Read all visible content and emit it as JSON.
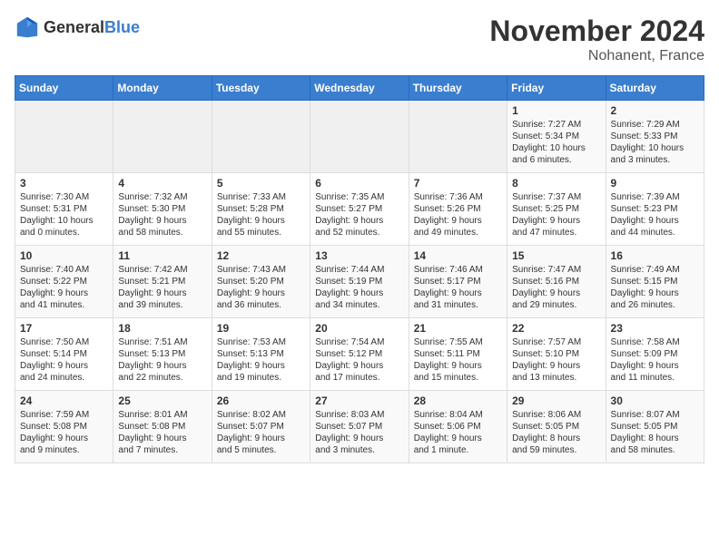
{
  "header": {
    "logo_general": "General",
    "logo_blue": "Blue",
    "title": "November 2024",
    "subtitle": "Nohanent, France"
  },
  "days_of_week": [
    "Sunday",
    "Monday",
    "Tuesday",
    "Wednesday",
    "Thursday",
    "Friday",
    "Saturday"
  ],
  "weeks": [
    [
      {
        "day": "",
        "info": ""
      },
      {
        "day": "",
        "info": ""
      },
      {
        "day": "",
        "info": ""
      },
      {
        "day": "",
        "info": ""
      },
      {
        "day": "",
        "info": ""
      },
      {
        "day": "1",
        "info": "Sunrise: 7:27 AM\nSunset: 5:34 PM\nDaylight: 10 hours\nand 6 minutes."
      },
      {
        "day": "2",
        "info": "Sunrise: 7:29 AM\nSunset: 5:33 PM\nDaylight: 10 hours\nand 3 minutes."
      }
    ],
    [
      {
        "day": "3",
        "info": "Sunrise: 7:30 AM\nSunset: 5:31 PM\nDaylight: 10 hours\nand 0 minutes."
      },
      {
        "day": "4",
        "info": "Sunrise: 7:32 AM\nSunset: 5:30 PM\nDaylight: 9 hours\nand 58 minutes."
      },
      {
        "day": "5",
        "info": "Sunrise: 7:33 AM\nSunset: 5:28 PM\nDaylight: 9 hours\nand 55 minutes."
      },
      {
        "day": "6",
        "info": "Sunrise: 7:35 AM\nSunset: 5:27 PM\nDaylight: 9 hours\nand 52 minutes."
      },
      {
        "day": "7",
        "info": "Sunrise: 7:36 AM\nSunset: 5:26 PM\nDaylight: 9 hours\nand 49 minutes."
      },
      {
        "day": "8",
        "info": "Sunrise: 7:37 AM\nSunset: 5:25 PM\nDaylight: 9 hours\nand 47 minutes."
      },
      {
        "day": "9",
        "info": "Sunrise: 7:39 AM\nSunset: 5:23 PM\nDaylight: 9 hours\nand 44 minutes."
      }
    ],
    [
      {
        "day": "10",
        "info": "Sunrise: 7:40 AM\nSunset: 5:22 PM\nDaylight: 9 hours\nand 41 minutes."
      },
      {
        "day": "11",
        "info": "Sunrise: 7:42 AM\nSunset: 5:21 PM\nDaylight: 9 hours\nand 39 minutes."
      },
      {
        "day": "12",
        "info": "Sunrise: 7:43 AM\nSunset: 5:20 PM\nDaylight: 9 hours\nand 36 minutes."
      },
      {
        "day": "13",
        "info": "Sunrise: 7:44 AM\nSunset: 5:19 PM\nDaylight: 9 hours\nand 34 minutes."
      },
      {
        "day": "14",
        "info": "Sunrise: 7:46 AM\nSunset: 5:17 PM\nDaylight: 9 hours\nand 31 minutes."
      },
      {
        "day": "15",
        "info": "Sunrise: 7:47 AM\nSunset: 5:16 PM\nDaylight: 9 hours\nand 29 minutes."
      },
      {
        "day": "16",
        "info": "Sunrise: 7:49 AM\nSunset: 5:15 PM\nDaylight: 9 hours\nand 26 minutes."
      }
    ],
    [
      {
        "day": "17",
        "info": "Sunrise: 7:50 AM\nSunset: 5:14 PM\nDaylight: 9 hours\nand 24 minutes."
      },
      {
        "day": "18",
        "info": "Sunrise: 7:51 AM\nSunset: 5:13 PM\nDaylight: 9 hours\nand 22 minutes."
      },
      {
        "day": "19",
        "info": "Sunrise: 7:53 AM\nSunset: 5:13 PM\nDaylight: 9 hours\nand 19 minutes."
      },
      {
        "day": "20",
        "info": "Sunrise: 7:54 AM\nSunset: 5:12 PM\nDaylight: 9 hours\nand 17 minutes."
      },
      {
        "day": "21",
        "info": "Sunrise: 7:55 AM\nSunset: 5:11 PM\nDaylight: 9 hours\nand 15 minutes."
      },
      {
        "day": "22",
        "info": "Sunrise: 7:57 AM\nSunset: 5:10 PM\nDaylight: 9 hours\nand 13 minutes."
      },
      {
        "day": "23",
        "info": "Sunrise: 7:58 AM\nSunset: 5:09 PM\nDaylight: 9 hours\nand 11 minutes."
      }
    ],
    [
      {
        "day": "24",
        "info": "Sunrise: 7:59 AM\nSunset: 5:08 PM\nDaylight: 9 hours\nand 9 minutes."
      },
      {
        "day": "25",
        "info": "Sunrise: 8:01 AM\nSunset: 5:08 PM\nDaylight: 9 hours\nand 7 minutes."
      },
      {
        "day": "26",
        "info": "Sunrise: 8:02 AM\nSunset: 5:07 PM\nDaylight: 9 hours\nand 5 minutes."
      },
      {
        "day": "27",
        "info": "Sunrise: 8:03 AM\nSunset: 5:07 PM\nDaylight: 9 hours\nand 3 minutes."
      },
      {
        "day": "28",
        "info": "Sunrise: 8:04 AM\nSunset: 5:06 PM\nDaylight: 9 hours\nand 1 minute."
      },
      {
        "day": "29",
        "info": "Sunrise: 8:06 AM\nSunset: 5:05 PM\nDaylight: 8 hours\nand 59 minutes."
      },
      {
        "day": "30",
        "info": "Sunrise: 8:07 AM\nSunset: 5:05 PM\nDaylight: 8 hours\nand 58 minutes."
      }
    ]
  ]
}
